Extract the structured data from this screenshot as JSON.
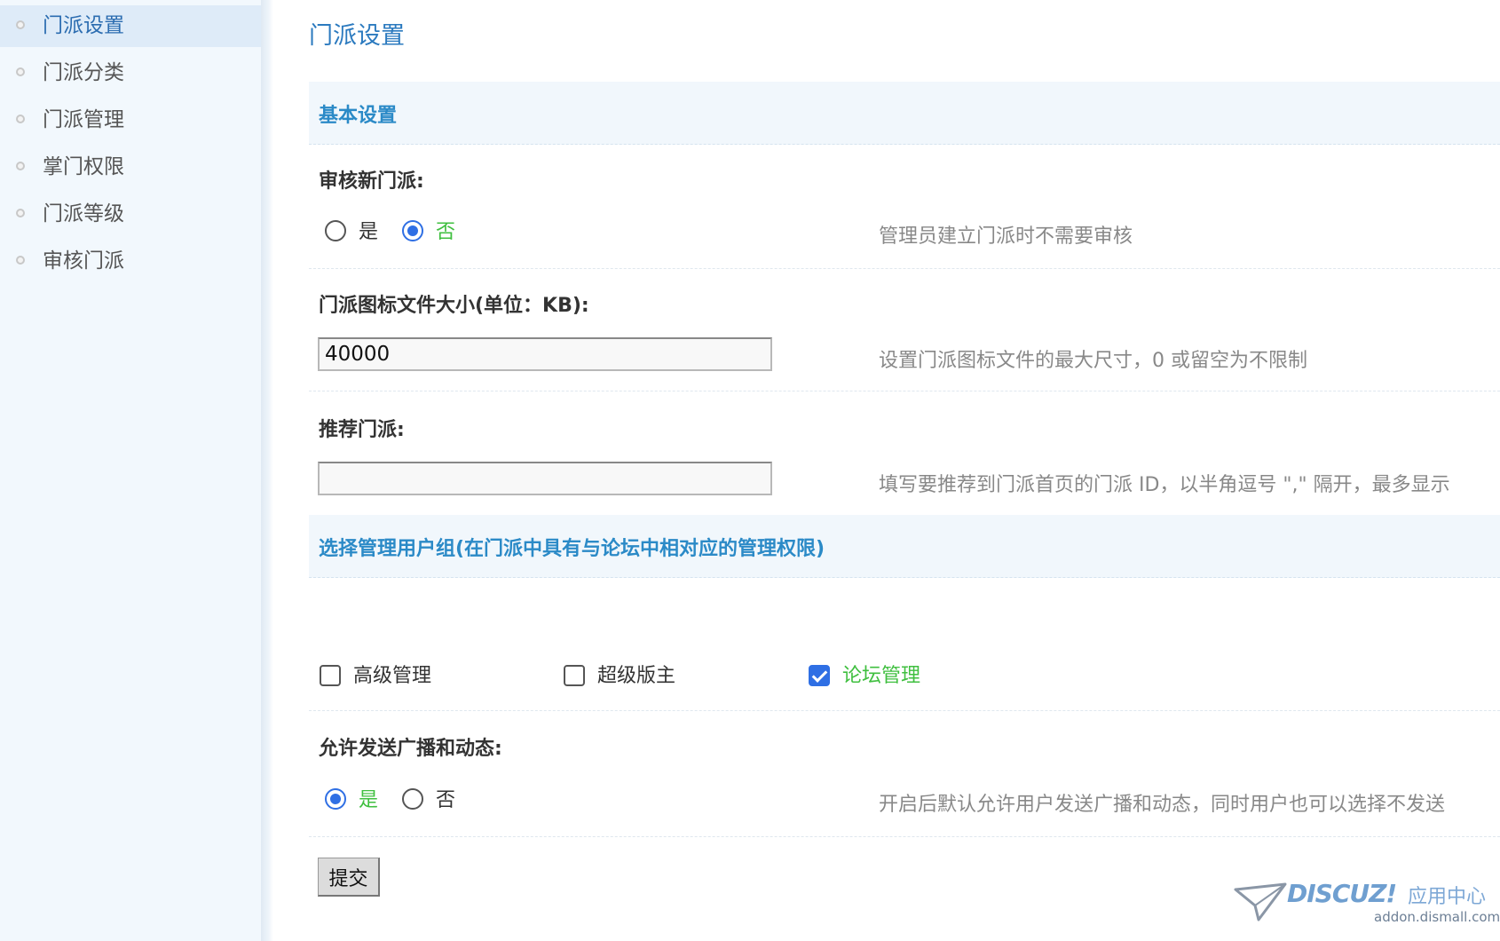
{
  "sidebar": {
    "items": [
      {
        "label": "门派设置",
        "active": true
      },
      {
        "label": "门派分类",
        "active": false
      },
      {
        "label": "门派管理",
        "active": false
      },
      {
        "label": "掌门权限",
        "active": false
      },
      {
        "label": "门派等级",
        "active": false
      },
      {
        "label": "审核门派",
        "active": false
      }
    ]
  },
  "main": {
    "title": "门派设置",
    "basic_section": "基本设置",
    "audit": {
      "label": "审核新门派:",
      "options": [
        "是",
        "否"
      ],
      "selected": "否",
      "hint": "管理员建立门派时不需要审核"
    },
    "icon_size": {
      "label": "门派图标文件大小(单位：KB):",
      "value": "40000",
      "hint": "设置门派图标文件的最大尺寸，0 或留空为不限制"
    },
    "recommend": {
      "label": "推荐门派:",
      "value": "",
      "hint": "填写要推荐到门派首页的门派 ID，以半角逗号 \",\" 隔开，最多显示"
    },
    "usergroup_section": "选择管理用户组(在门派中具有与论坛中相对应的管理权限)",
    "usergroups": [
      {
        "label": "高级管理",
        "checked": false
      },
      {
        "label": "超级版主",
        "checked": false
      },
      {
        "label": "论坛管理",
        "checked": true
      }
    ],
    "broadcast": {
      "label": "允许发送广播和动态:",
      "options": [
        "是",
        "否"
      ],
      "selected": "是",
      "hint": "开启后默认允许用户发送广播和动态，同时用户也可以选择不发送"
    },
    "submit_label": "提交"
  },
  "watermark": {
    "brand": "DISCUZ!",
    "sub": "应用中心",
    "url": "addon.dismall.com"
  },
  "colors": {
    "accent": "#2b7abf",
    "sidebar_bg": "#f2f8fd",
    "selected_green": "#3fbf3f",
    "control_blue": "#2f6fe4"
  }
}
